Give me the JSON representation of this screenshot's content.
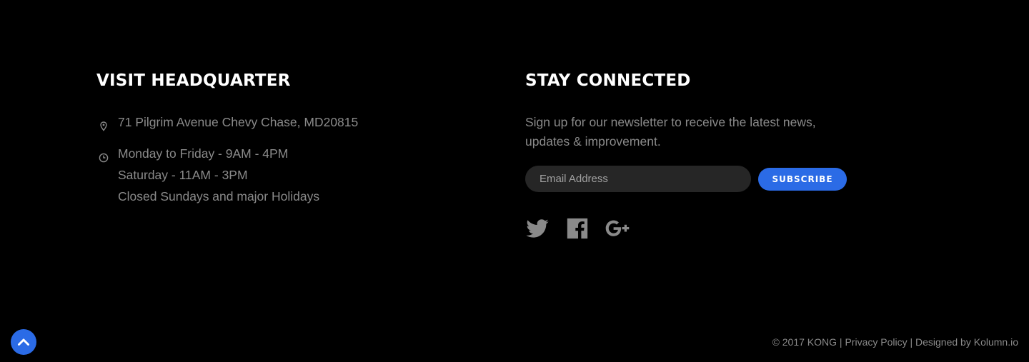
{
  "headquarter": {
    "title": "VISIT HEADQUARTER",
    "address": "71 Pilgrim Avenue Chevy Chase, MD20815",
    "hours": [
      "Monday to Friday - 9AM - 4PM",
      "Saturday - 11AM - 3PM",
      "Closed Sundays and major Holidays"
    ],
    "address_icon": "map-pin-icon",
    "hours_icon": "clock-icon"
  },
  "newsletter": {
    "title": "STAY CONNECTED",
    "description": "Sign up for our newsletter to receive the latest news, updates & improvement.",
    "email_placeholder": "Email Address",
    "subscribe_label": "SUBSCRIBE"
  },
  "social": [
    {
      "name": "twitter",
      "icon": "twitter-icon"
    },
    {
      "name": "facebook",
      "icon": "facebook-icon"
    },
    {
      "name": "google-plus",
      "icon": "google-plus-icon"
    }
  ],
  "footer": {
    "copyright": "© 2017 KONG",
    "separator": " | ",
    "privacy_label": "Privacy Policy",
    "designed_by": "Designed by Kolumn.io",
    "back_to_top_icon": "chevron-up-icon"
  },
  "colors": {
    "background": "#000000",
    "heading": "#ffffff",
    "text": "#8a8a8a",
    "accent": "#2b6be6",
    "input_bg": "#262626"
  }
}
